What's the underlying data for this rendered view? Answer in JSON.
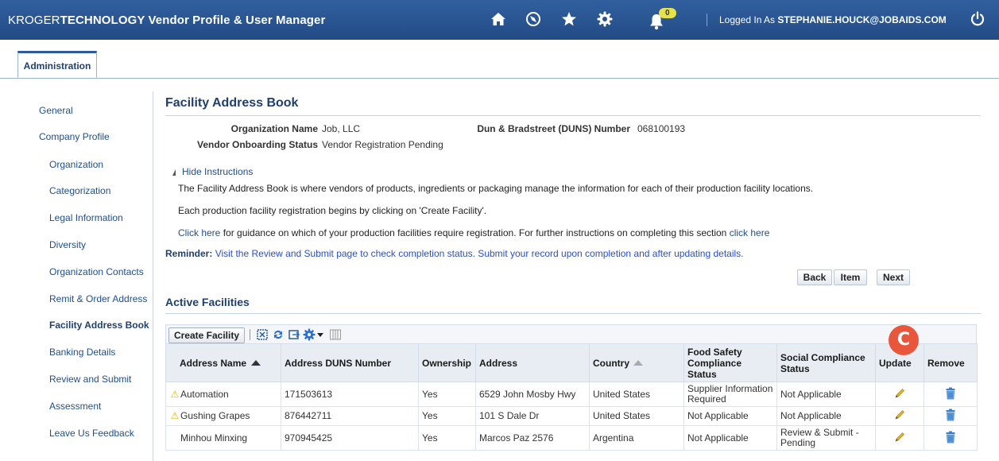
{
  "header": {
    "brand_part1": "KROGER",
    "brand_part2": "TECHNOLOGY",
    "app_title": "Vendor Profile & User Manager",
    "notification_count": "0",
    "logged_in_prefix": "Logged In As",
    "logged_in_user": "STEPHANIE.HOUCK@JOBAIDS.COM",
    "icons": [
      "home-icon",
      "compass-icon",
      "star-icon",
      "gear-icon",
      "bell-icon",
      "power-icon"
    ]
  },
  "tabs": [
    {
      "label": "Administration"
    }
  ],
  "sidebar": {
    "items": [
      {
        "label": "General"
      },
      {
        "label": "Company Profile"
      },
      {
        "label": "Organization"
      },
      {
        "label": "Categorization"
      },
      {
        "label": "Legal Information"
      },
      {
        "label": "Diversity"
      },
      {
        "label": "Organization Contacts"
      },
      {
        "label": "Remit & Order Address"
      },
      {
        "label": "Facility Address Book"
      },
      {
        "label": "Banking Details"
      },
      {
        "label": "Review and Submit"
      },
      {
        "label": "Assessment"
      },
      {
        "label": "Leave Us Feedback"
      }
    ]
  },
  "page": {
    "title": "Facility Address Book",
    "org_name_label": "Organization Name",
    "org_name_value": "Job, LLC",
    "duns_label": "Dun & Bradstreet (DUNS) Number",
    "duns_value": "068100193",
    "onboarding_label": "Vendor Onboarding Status",
    "onboarding_value": "Vendor Registration Pending",
    "hide_instructions": "Hide Instructions",
    "instr_line1": "The Facility Address Book is where vendors of products, ingredients or packaging manage the information for each of their production facility locations.",
    "instr_line2": "Each production facility registration begins by clicking on 'Create Facility'.",
    "instr_line3_link1": "Click here",
    "instr_line3_mid": "for guidance on which of your production facilities require registration. For further instructions on completing this section",
    "instr_line3_link2": "click here",
    "reminder_label": "Reminder:",
    "reminder_text": "Visit the Review and Submit page to check completion status. Submit your record upon completion and after updating details.",
    "btn_back": "Back",
    "btn_item": "Item",
    "btn_next": "Next",
    "section_title": "Active Facilities",
    "create_facility": "Create Facility",
    "callout": "C"
  },
  "table": {
    "headers": {
      "address_name": "Address Name",
      "duns": "Address DUNS Number",
      "ownership": "Ownership",
      "address": "Address",
      "country": "Country",
      "food_safety": "Food Safety Compliance Status",
      "social": "Social Compliance Status",
      "update": "Update",
      "remove": "Remove"
    },
    "rows": [
      {
        "warning": true,
        "name": "Automation",
        "duns": "171503613",
        "ownership": "Yes",
        "address": "6529 John Mosby Hwy",
        "country": "United States",
        "food_safety": "Supplier Information Required",
        "social": "Not Applicable"
      },
      {
        "warning": true,
        "name": "Gushing Grapes",
        "duns": "876442711",
        "ownership": "Yes",
        "address": "101 S Dale Dr",
        "country": "United States",
        "food_safety": "Not Applicable",
        "social": "Not Applicable"
      },
      {
        "warning": false,
        "name": "Minhou Minxing",
        "duns": "970945425",
        "ownership": "Yes",
        "address": "Marcos Paz 2576",
        "country": "Argentina",
        "food_safety": "Not Applicable",
        "social": "Review & Submit - Pending"
      }
    ]
  }
}
